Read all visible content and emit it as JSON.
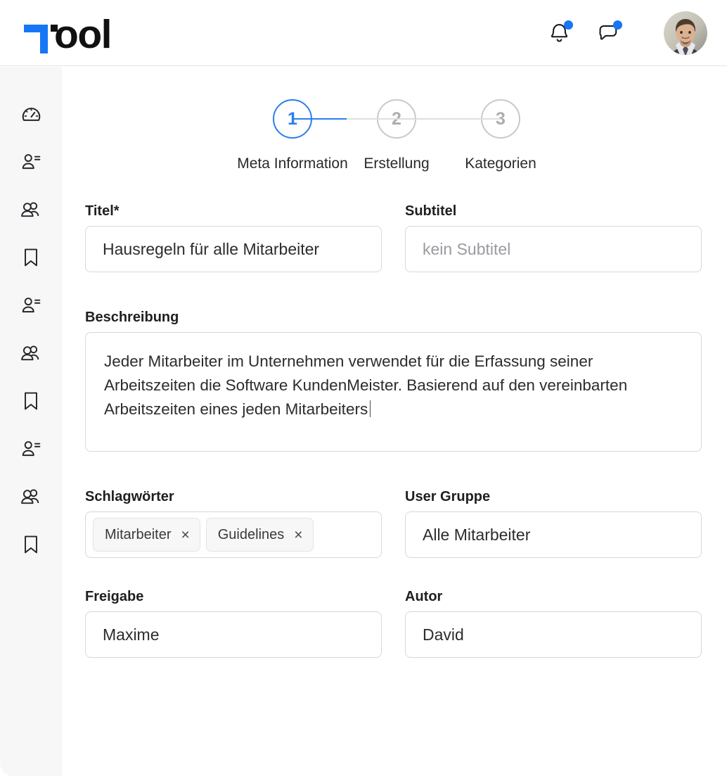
{
  "header": {
    "logo_mark": "t-logo-mark",
    "logo_text": "ool",
    "notifications_icon": "bell-icon",
    "notifications_badge": "",
    "messages_icon": "chat-bubble-icon",
    "messages_badge": "",
    "avatar_alt": "user-avatar"
  },
  "colors": {
    "accent": "#1577f5",
    "step_active": "#2a7ef0",
    "step_inactive": "#c9c9cd",
    "sidebar_bg": "#f7f7f8",
    "border": "#d8d8dc",
    "badge": "#1577f5"
  },
  "sidebar": {
    "items": [
      {
        "icon": "dashboard-gauge-icon",
        "name": "sidebar-item-dashboard"
      },
      {
        "icon": "user-list-icon",
        "name": "sidebar-item-user-list-1"
      },
      {
        "icon": "users-group-icon",
        "name": "sidebar-item-users-group-1"
      },
      {
        "icon": "bookmark-icon",
        "name": "sidebar-item-bookmark-1"
      },
      {
        "icon": "user-list-icon",
        "name": "sidebar-item-user-list-2"
      },
      {
        "icon": "users-group-icon",
        "name": "sidebar-item-users-group-2"
      },
      {
        "icon": "bookmark-icon",
        "name": "sidebar-item-bookmark-2"
      },
      {
        "icon": "user-list-icon",
        "name": "sidebar-item-user-list-3"
      },
      {
        "icon": "users-group-icon",
        "name": "sidebar-item-users-group-3"
      },
      {
        "icon": "bookmark-icon",
        "name": "sidebar-item-bookmark-3"
      }
    ]
  },
  "stepper": {
    "steps": [
      {
        "number": "1",
        "label": "Meta Information",
        "active": true
      },
      {
        "number": "2",
        "label": "Erstellung",
        "active": false
      },
      {
        "number": "3",
        "label": "Kategorien",
        "active": false
      }
    ],
    "connector_1_progress_pct": 52,
    "connector_2_progress_pct": 0
  },
  "form": {
    "title": {
      "label": "Titel*",
      "value": "Hausregeln für alle Mitarbeiter"
    },
    "subtitle": {
      "label": "Subtitel",
      "value": "",
      "placeholder": "kein Subtitel"
    },
    "description": {
      "label": "Beschreibung",
      "value": "Jeder Mitarbeiter im Unternehmen verwendet für die Erfassung seiner Arbeitszeiten die Software KundenMeister. Basierend auf den vereinbarten Arbeitszeiten eines jeden Mitarbeiters"
    },
    "tags": {
      "label": "Schlagwörter",
      "items": [
        {
          "label": "Mitarbeiter",
          "remove": "×"
        },
        {
          "label": "Guidelines",
          "remove": "×"
        }
      ]
    },
    "user_group": {
      "label": "User Gruppe",
      "value": "Alle Mitarbeiter"
    },
    "release": {
      "label": "Freigabe",
      "value": "Maxime"
    },
    "author": {
      "label": "Autor",
      "value": "David"
    }
  }
}
